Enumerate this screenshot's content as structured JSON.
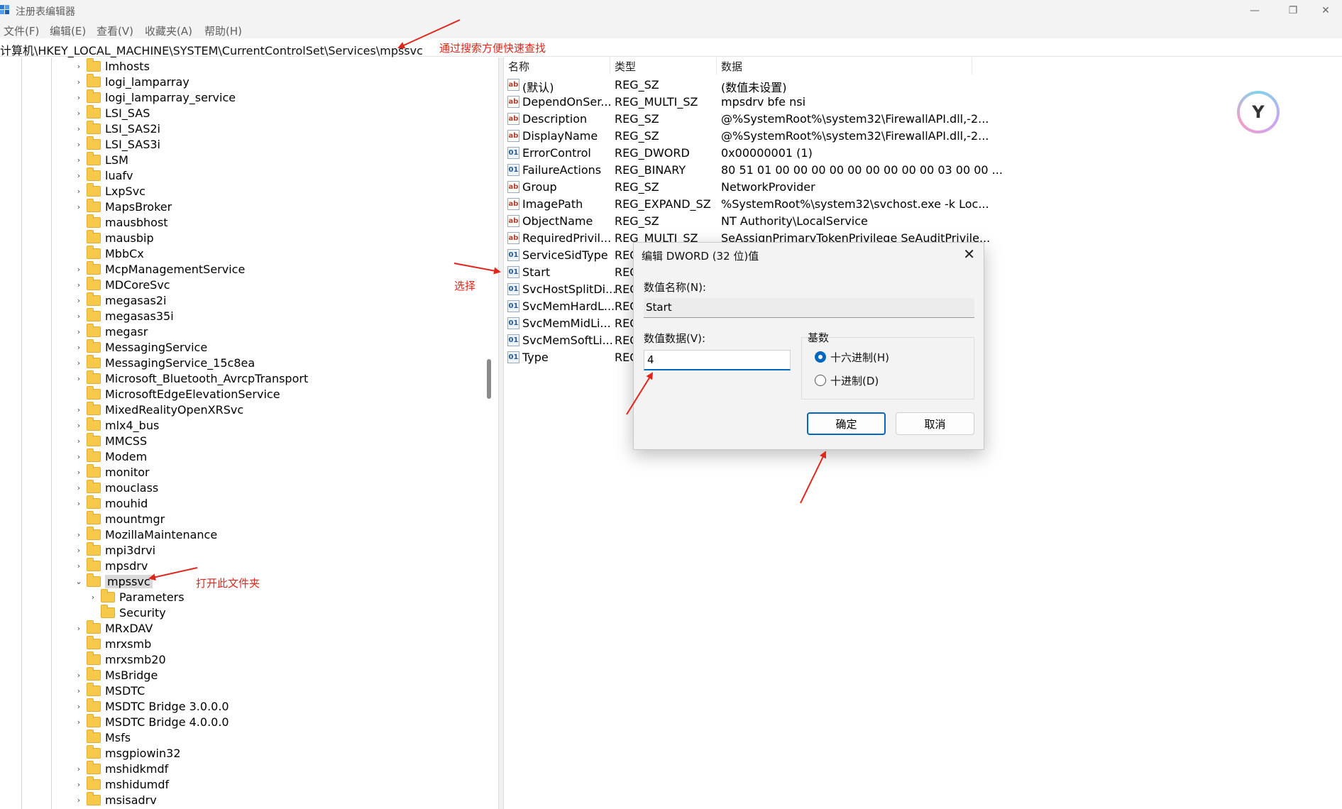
{
  "window": {
    "title": "注册表编辑器",
    "minimize_glyph": "—",
    "maximize_glyph": "❐",
    "close_glyph": "✕"
  },
  "menu": [
    "文件(F)",
    "编辑(E)",
    "查看(V)",
    "收藏夹(A)",
    "帮助(H)"
  ],
  "address": "计算机\\HKEY_LOCAL_MACHINE\\SYSTEM\\CurrentControlSet\\Services\\mpssvc",
  "tree": [
    {
      "label": "lmhosts",
      "chevron": "›"
    },
    {
      "label": "logi_lamparray",
      "chevron": "›"
    },
    {
      "label": "logi_lamparray_service",
      "chevron": "›"
    },
    {
      "label": "LSI_SAS",
      "chevron": "›"
    },
    {
      "label": "LSI_SAS2i",
      "chevron": "›"
    },
    {
      "label": "LSI_SAS3i",
      "chevron": "›"
    },
    {
      "label": "LSM",
      "chevron": "›"
    },
    {
      "label": "luafv",
      "chevron": "›"
    },
    {
      "label": "LxpSvc",
      "chevron": "›"
    },
    {
      "label": "MapsBroker",
      "chevron": "›"
    },
    {
      "label": "mausbhost",
      "chevron": ""
    },
    {
      "label": "mausbip",
      "chevron": ""
    },
    {
      "label": "MbbCx",
      "chevron": ""
    },
    {
      "label": "McpManagementService",
      "chevron": "›"
    },
    {
      "label": "MDCoreSvc",
      "chevron": "›"
    },
    {
      "label": "megasas2i",
      "chevron": "›"
    },
    {
      "label": "megasas35i",
      "chevron": "›"
    },
    {
      "label": "megasr",
      "chevron": "›"
    },
    {
      "label": "MessagingService",
      "chevron": "›"
    },
    {
      "label": "MessagingService_15c8ea",
      "chevron": "›"
    },
    {
      "label": "Microsoft_Bluetooth_AvrcpTransport",
      "chevron": "›"
    },
    {
      "label": "MicrosoftEdgeElevationService",
      "chevron": ""
    },
    {
      "label": "MixedRealityOpenXRSvc",
      "chevron": "›"
    },
    {
      "label": "mlx4_bus",
      "chevron": "›"
    },
    {
      "label": "MMCSS",
      "chevron": "›"
    },
    {
      "label": "Modem",
      "chevron": "›"
    },
    {
      "label": "monitor",
      "chevron": "›"
    },
    {
      "label": "mouclass",
      "chevron": "›"
    },
    {
      "label": "mouhid",
      "chevron": "›"
    },
    {
      "label": "mountmgr",
      "chevron": ""
    },
    {
      "label": "MozillaMaintenance",
      "chevron": "›"
    },
    {
      "label": "mpi3drvi",
      "chevron": "›"
    },
    {
      "label": "mpsdrv",
      "chevron": "›"
    },
    {
      "label": "mpssvc",
      "chevron": "⌄",
      "selected": true
    },
    {
      "label": "Parameters",
      "chevron": "›",
      "child": true
    },
    {
      "label": "Security",
      "chevron": "",
      "child": true
    },
    {
      "label": "MRxDAV",
      "chevron": "›"
    },
    {
      "label": "mrxsmb",
      "chevron": ""
    },
    {
      "label": "mrxsmb20",
      "chevron": ""
    },
    {
      "label": "MsBridge",
      "chevron": "›"
    },
    {
      "label": "MSDTC",
      "chevron": "›"
    },
    {
      "label": "MSDTC Bridge 3.0.0.0",
      "chevron": "›"
    },
    {
      "label": "MSDTC Bridge 4.0.0.0",
      "chevron": "›"
    },
    {
      "label": "Msfs",
      "chevron": ""
    },
    {
      "label": "msgpiowin32",
      "chevron": ""
    },
    {
      "label": "mshidkmdf",
      "chevron": "›"
    },
    {
      "label": "mshidumdf",
      "chevron": "›"
    },
    {
      "label": "msisadrv",
      "chevron": "›"
    }
  ],
  "values_header": {
    "name": "名称",
    "type": "类型",
    "data": "数据"
  },
  "values": [
    {
      "icon": "string-value-icon",
      "glyph": "ab",
      "name": "(默认)",
      "type": "REG_SZ",
      "data": "(数值未设置)"
    },
    {
      "icon": "string-value-icon",
      "glyph": "ab",
      "name": "DependOnSer...",
      "type": "REG_MULTI_SZ",
      "data": "mpsdrv bfe nsi"
    },
    {
      "icon": "string-value-icon",
      "glyph": "ab",
      "name": "Description",
      "type": "REG_SZ",
      "data": "@%SystemRoot%\\system32\\FirewallAPI.dll,-2..."
    },
    {
      "icon": "string-value-icon",
      "glyph": "ab",
      "name": "DisplayName",
      "type": "REG_SZ",
      "data": "@%SystemRoot%\\system32\\FirewallAPI.dll,-2..."
    },
    {
      "icon": "binary-value-icon",
      "glyph": "01",
      "name": "ErrorControl",
      "type": "REG_DWORD",
      "data": "0x00000001 (1)"
    },
    {
      "icon": "binary-value-icon",
      "glyph": "01",
      "name": "FailureActions",
      "type": "REG_BINARY",
      "data": "80 51 01 00 00 00 00 00 00 00 00 00 03 00 00 ..."
    },
    {
      "icon": "string-value-icon",
      "glyph": "ab",
      "name": "Group",
      "type": "REG_SZ",
      "data": "NetworkProvider"
    },
    {
      "icon": "string-value-icon",
      "glyph": "ab",
      "name": "ImagePath",
      "type": "REG_EXPAND_SZ",
      "data": "%SystemRoot%\\system32\\svchost.exe -k Loc..."
    },
    {
      "icon": "string-value-icon",
      "glyph": "ab",
      "name": "ObjectName",
      "type": "REG_SZ",
      "data": "NT Authority\\LocalService"
    },
    {
      "icon": "string-value-icon",
      "glyph": "ab",
      "name": "RequiredPrivil...",
      "type": "REG_MULTI_SZ",
      "data": "SeAssignPrimaryTokenPrivilege SeAuditPrivile..."
    },
    {
      "icon": "binary-value-icon",
      "glyph": "01",
      "name": "ServiceSidType",
      "type": "REG",
      "data": ""
    },
    {
      "icon": "binary-value-icon",
      "glyph": "01",
      "name": "Start",
      "type": "REG",
      "data": ""
    },
    {
      "icon": "binary-value-icon",
      "glyph": "01",
      "name": "SvcHostSplitDi...",
      "type": "REG",
      "data": ""
    },
    {
      "icon": "binary-value-icon",
      "glyph": "01",
      "name": "SvcMemHardL...",
      "type": "REG",
      "data": ""
    },
    {
      "icon": "binary-value-icon",
      "glyph": "01",
      "name": "SvcMemMidLi...",
      "type": "REG",
      "data": ""
    },
    {
      "icon": "binary-value-icon",
      "glyph": "01",
      "name": "SvcMemSoftLi...",
      "type": "REG",
      "data": ""
    },
    {
      "icon": "binary-value-icon",
      "glyph": "01",
      "name": "Type",
      "type": "REG",
      "data": ""
    }
  ],
  "dialog": {
    "title": "编辑 DWORD (32 位)值",
    "close_glyph": "✕",
    "name_label": "数值名称(N):",
    "name_value": "Start",
    "data_label": "数值数据(V):",
    "data_value": "4",
    "base_label": "基数",
    "hex_label": "十六进制(H)",
    "dec_label": "十进制(D)",
    "selected_base": "hex",
    "ok_label": "确定",
    "cancel_label": "取消"
  },
  "annotations": {
    "search_tip": "通过搜索方便快速查找",
    "select_tip": "选择",
    "open_folder_tip": "打开此文件夹"
  },
  "colors": {
    "annotation": "#e0261b",
    "accent": "#0067c0",
    "folder": "#f6c94b"
  },
  "logo": {
    "glyph": "Y"
  }
}
